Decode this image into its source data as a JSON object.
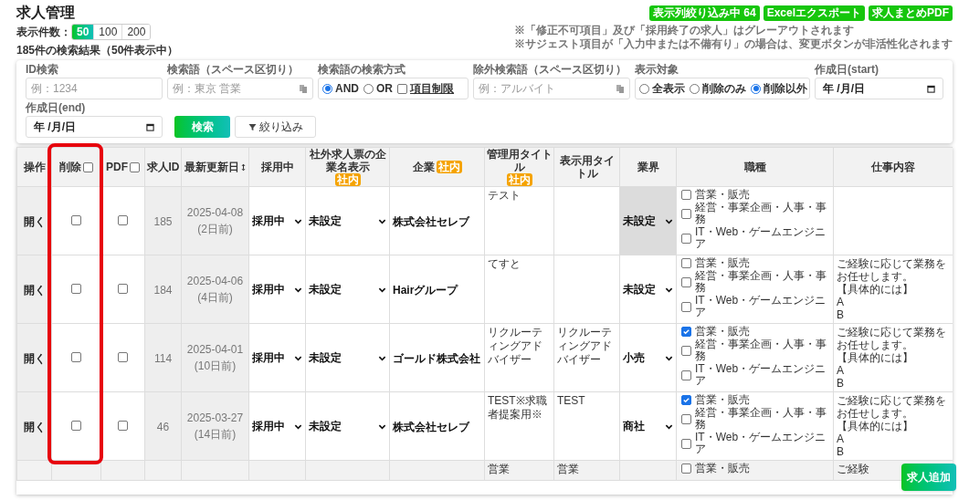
{
  "page_title": "求人管理",
  "header_buttons": [
    {
      "label": "表示列絞り込み中 64"
    },
    {
      "label": "Excelエクスポート"
    },
    {
      "label": "求人まとめPDF"
    }
  ],
  "page_size": {
    "label": "表示件数：",
    "options": [
      {
        "label": "50",
        "selected": true
      },
      {
        "label": "100",
        "selected": false
      },
      {
        "label": "200",
        "selected": false
      }
    ]
  },
  "notes": [
    "※「修正不可項目」及び「採用終了の求人」はグレーアウトされます",
    "※サジェスト項目が「入力中または不備有り」の場合は、変更ボタンが非活性化されます"
  ],
  "result_summary": "185件の検索結果（50件表示中）",
  "filters": [
    {
      "kind": "text",
      "label": "ID検索",
      "placeholder": "例：1234"
    },
    {
      "kind": "text",
      "label": "検索語（スペース区切り）",
      "placeholder": "例：東京 営業",
      "paste_icon": true
    },
    {
      "kind": "radio",
      "label": "検索語の検索方式",
      "options": [
        {
          "label": "AND",
          "selected": true
        },
        {
          "label": "OR",
          "selected": false
        }
      ],
      "checkbox": {
        "label": "項目制限",
        "checked": false
      }
    },
    {
      "kind": "text",
      "label": "除外検索語（スペース区切り）",
      "placeholder": "例：アルバイト",
      "paste_icon": true
    },
    {
      "kind": "radio",
      "label": "表示対象",
      "options": [
        {
          "label": "全表示",
          "selected": false
        },
        {
          "label": "削除のみ",
          "selected": false
        },
        {
          "label": "削除以外",
          "selected": true
        }
      ]
    },
    {
      "kind": "date",
      "label": "作成日(start)",
      "value": "年 /月/日"
    },
    {
      "kind": "date",
      "label": "作成日(end)",
      "value": "年 /月/日"
    }
  ],
  "filter_buttons": [
    {
      "kind": "primary",
      "label": "検索"
    },
    {
      "kind": "filter",
      "label": "絞り込み"
    }
  ],
  "table": {
    "columns": [
      {
        "label": "操作"
      },
      {
        "label": "削除",
        "checkbox": {
          "checked": false
        }
      },
      {
        "label": "PDF",
        "checkbox": {
          "checked": false
        }
      },
      {
        "label": "求人ID"
      },
      {
        "label": "最新更新日",
        "sort_icon": true
      },
      {
        "label": "採用中"
      },
      {
        "label": "社外求人票の企業名表示",
        "badge": "社内"
      },
      {
        "label": "企業",
        "badge": "社内"
      },
      {
        "label": "管理用タイトル",
        "badge": "社内"
      },
      {
        "label": "表示用タイトル"
      },
      {
        "label": "業界"
      },
      {
        "label": "職種"
      },
      {
        "label": "仕事内容"
      }
    ],
    "rows": [
      {
        "greyed": false,
        "action": "開く",
        "delete_checked": false,
        "pdf_checked": false,
        "id": "185",
        "updated": "2025-04-08",
        "updated_ago": "(2日前)",
        "status": "採用中",
        "company_display": "未設定",
        "company": "株式会社セレブ",
        "admin_title": "テスト",
        "industry": "未設定",
        "industry_disabled": true,
        "job_types": [
          {
            "label": "営業・販売",
            "checked": false
          },
          {
            "label": "経営・事業企画・人事・事務",
            "checked": false
          },
          {
            "label": "IT・Web・ゲームエンジニア",
            "checked": false
          }
        ]
      },
      {
        "greyed": false,
        "action": "開く",
        "delete_checked": false,
        "pdf_checked": false,
        "id": "184",
        "updated": "2025-04-06",
        "updated_ago": "(4日前)",
        "status": "採用中",
        "company_display": "未設定",
        "company": "Hairグループ",
        "admin_title": "てすと",
        "industry": "未設定",
        "industry_disabled": false,
        "job_types": [
          {
            "label": "営業・販売",
            "checked": false
          },
          {
            "label": "経営・事業企画・人事・事務",
            "checked": false
          },
          {
            "label": "IT・Web・ゲームエンジニア",
            "checked": false
          }
        ],
        "job_detail": [
          "ご経験に応じて業務を",
          "お任せします。",
          "【具体的には】",
          "A",
          "B"
        ]
      },
      {
        "greyed": false,
        "action": "開く",
        "delete_checked": false,
        "pdf_checked": false,
        "id": "114",
        "updated": "2025-04-01",
        "updated_ago": "(10日前)",
        "status": "採用中",
        "company_display": "未設定",
        "company": "ゴールド株式会社",
        "admin_title": "リクルーティングアドバイザー",
        "display_title": "リクルーティングアドバイザー",
        "industry": "小売",
        "industry_disabled": false,
        "job_types": [
          {
            "label": "営業・販売",
            "checked": true
          },
          {
            "label": "経営・事業企画・人事・事務",
            "checked": false
          },
          {
            "label": "IT・Web・ゲームエンジニア",
            "checked": false
          }
        ],
        "job_detail": [
          "ご経験に応じて業務を",
          "お任せします。",
          "【具体的には】",
          "A",
          "B"
        ]
      },
      {
        "greyed": false,
        "action": "開く",
        "delete_checked": false,
        "pdf_checked": false,
        "id": "46",
        "updated": "2025-03-27",
        "updated_ago": "(14日前)",
        "status": "採用中",
        "company_display": "未設定",
        "company": "株式会社セレブ",
        "admin_title": "TEST※求職者提案用※",
        "display_title": "TEST",
        "industry": "商社",
        "industry_disabled": false,
        "job_types": [
          {
            "label": "営業・販売",
            "checked": true
          },
          {
            "label": "経営・事業企画・人事・事務",
            "checked": false
          },
          {
            "label": "IT・Web・ゲームエンジニア",
            "checked": false
          }
        ],
        "job_detail": [
          "ご経験に応じて業務を",
          "お任せします。",
          "【具体的には】",
          "A",
          "B"
        ]
      },
      {
        "greyed": true,
        "admin_title": "営業",
        "display_title": "営業",
        "job_types": [
          {
            "label": "営業・販売",
            "checked": false
          }
        ],
        "job_detail": [
          "ご経験"
        ]
      }
    ]
  },
  "add_button": {
    "label": "求人追加"
  }
}
